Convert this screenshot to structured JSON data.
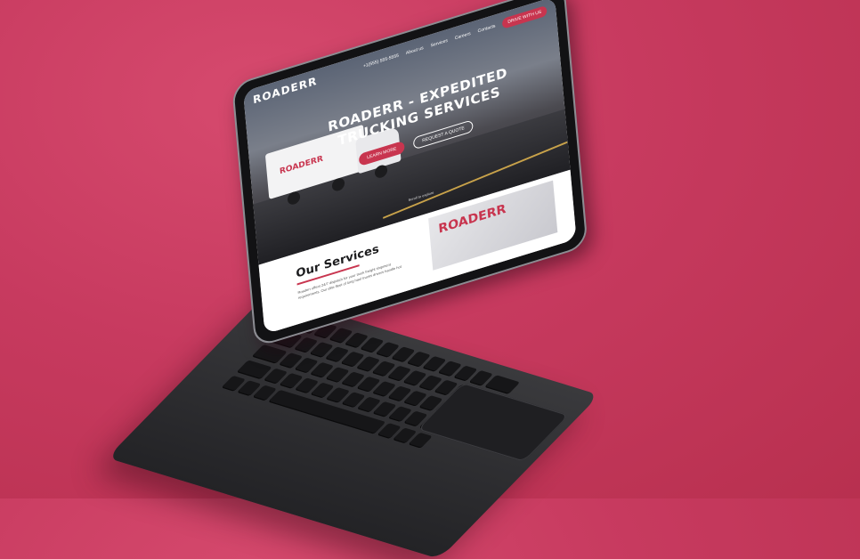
{
  "site": {
    "brand": "ROADERR",
    "nav": {
      "phone": "+1(555) 555-5555",
      "links": [
        "About us",
        "Services",
        "Careers",
        "Contacts"
      ],
      "cta": "DRIVE WITH US"
    },
    "hero": {
      "title_line1": "ROADERR - EXPEDITED",
      "title_line2": "TRUCKING SERVICES",
      "primary_button": "LEARN MORE",
      "secondary_button": "REQUEST A QUOTE",
      "scroll_hint": "Scroll to explore"
    },
    "trailer_logo": "ROADERR",
    "services": {
      "title": "Our Services",
      "text": "Roaderr offers 24/7 dispatch for your truck freight shipment requirements. Our elite fleet of long haul trucks drivers handle hot",
      "image_label": "ROADERR"
    }
  },
  "colors": {
    "background": "#c73a5f",
    "accent": "#c8354f",
    "device": "#2c2c2f"
  }
}
